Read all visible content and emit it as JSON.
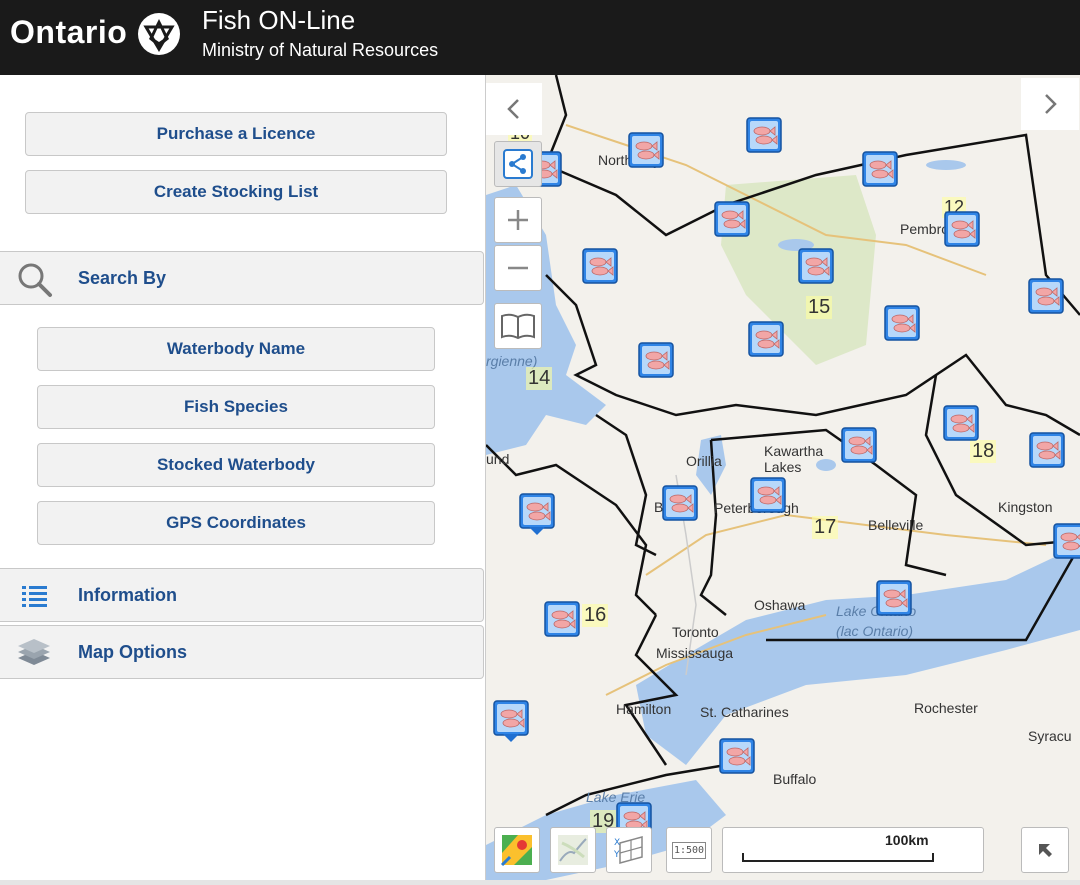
{
  "header": {
    "brand": "Ontario",
    "title": "Fish ON-Line",
    "subtitle": "Ministry of Natural Resources"
  },
  "sidebar": {
    "purchase_licence": "Purchase a Licence",
    "create_stocking_list": "Create Stocking List",
    "search_by": {
      "label": "Search By",
      "items": [
        "Waterbody Name",
        "Fish Species",
        "Stocked Waterbody",
        "GPS Coordinates"
      ]
    },
    "information": "Information",
    "map_options": "Map Options"
  },
  "map": {
    "places": {
      "north_bay": "North Bay",
      "pembroke": "Pembroke",
      "orillia": "Orillia",
      "kawartha": "Kawartha",
      "lakes": "Lakes",
      "peterborough": "Peterborough",
      "belleville": "Belleville",
      "kingston": "Kingston",
      "oshawa": "Oshawa",
      "toronto": "Toronto",
      "mississauga": "Mississauga",
      "hamilton": "Hamilton",
      "st_catharines": "St. Catharines",
      "rochester": "Rochester",
      "buffalo": "Buffalo",
      "syracuse": "Syracu",
      "barrie": "B",
      "georgienne": "rgienne)",
      "sound": "und"
    },
    "water": {
      "lake_ontario": "Lake Ontario",
      "lac_ontario": "(lac Ontario)",
      "lake_erie": "Lake Erie"
    },
    "zones": [
      "10",
      "12",
      "15",
      "14",
      "18",
      "17",
      "16",
      "19"
    ],
    "scale": {
      "label": "100km",
      "ratio": "1:500"
    }
  }
}
